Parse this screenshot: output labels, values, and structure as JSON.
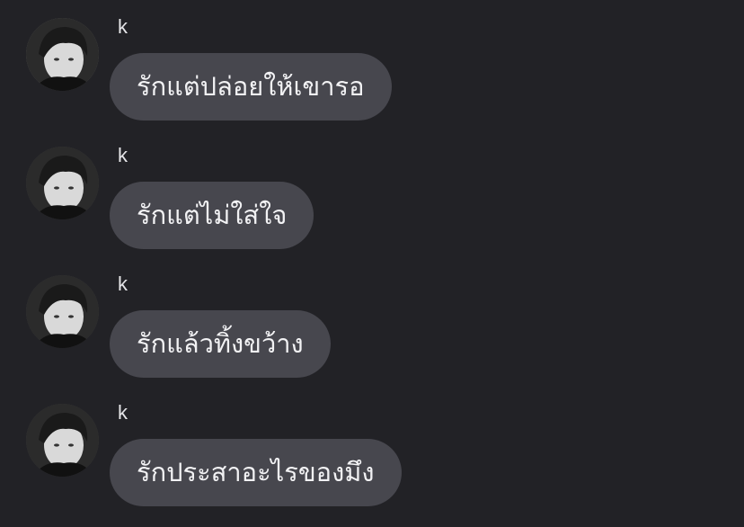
{
  "messages": [
    {
      "sender": "k",
      "text": "รักแต่ปล่อยให้เขารอ",
      "avatar_icon": "profile-photo"
    },
    {
      "sender": "k",
      "text": "รักแต่ไม่ใส่ใจ",
      "avatar_icon": "profile-photo"
    },
    {
      "sender": "k",
      "text": "รักแล้วทิ้งขว้าง",
      "avatar_icon": "profile-photo"
    },
    {
      "sender": "k",
      "text": "รักประสาอะไรของมึง",
      "avatar_icon": "profile-photo"
    }
  ],
  "colors": {
    "background": "#222226",
    "bubble": "#47474e",
    "text": "#f2f2f4"
  }
}
